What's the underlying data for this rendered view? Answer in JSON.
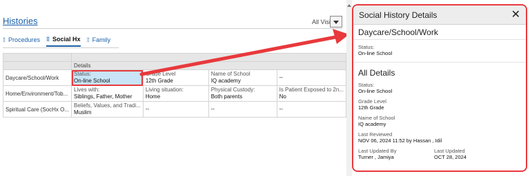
{
  "histories": {
    "title": "Histories",
    "all_visits_label": "All Visits"
  },
  "tabs": [
    {
      "label": "Procedures",
      "active": false
    },
    {
      "label": "Social Hx",
      "active": true
    },
    {
      "label": "Family",
      "active": false
    }
  ],
  "grid": {
    "details_header": "Details",
    "rows": [
      {
        "name": "Daycare/School/Work",
        "cells": [
          {
            "label": "Status:",
            "value": "On-line School"
          },
          {
            "label": "Grade Level",
            "value": "12th Grade"
          },
          {
            "label": "Name of School",
            "value": "IQ academy"
          },
          {
            "label": "",
            "value": "--"
          }
        ]
      },
      {
        "name": "Home/Environment/Tob...",
        "cells": [
          {
            "label": "Lives with:",
            "value": "Siblings, Father, Mother"
          },
          {
            "label": "Living situation:",
            "value": "Home"
          },
          {
            "label": "Physical Custody:",
            "value": "Both parents"
          },
          {
            "label": "Is Patient Exposed to 2n...",
            "value": "No"
          }
        ]
      },
      {
        "name": "Spiritual Care (SocHx O...",
        "cells": [
          {
            "label": "Beliefs, Values, and Tradi...",
            "value": "Muslim"
          },
          {
            "label": "",
            "value": "--"
          },
          {
            "label": "",
            "value": "--"
          },
          {
            "label": "",
            "value": "--"
          }
        ]
      }
    ]
  },
  "panel": {
    "title": "Social History Details",
    "section1_title": "Daycare/School/Work",
    "status_label": "Status:",
    "status_value": "On-line School",
    "section2_title": "All Details",
    "details": [
      {
        "label": "Status:",
        "value": "On-line School"
      },
      {
        "label": "Grade Level",
        "value": "12th Grade"
      },
      {
        "label": "Name of School",
        "value": "IQ academy"
      },
      {
        "label": "Last Reviewed",
        "value": "NOV 06, 2024 11:52 by Hassan , Idil"
      }
    ],
    "last_updated_by_label": "Last Updated By",
    "last_updated_by_value": "Turner , Jamiya",
    "last_updated_label": "Last Updated",
    "last_updated_value": "OCT 28, 2024"
  },
  "colors": {
    "accent": "#1a5fa8",
    "highlight_red": "#e8393c",
    "selected_cell": "#c9e4f7"
  },
  "icons": {
    "close": "close-icon",
    "dropdown": "chevron-down-icon",
    "tab_grip": "grip-icon"
  }
}
